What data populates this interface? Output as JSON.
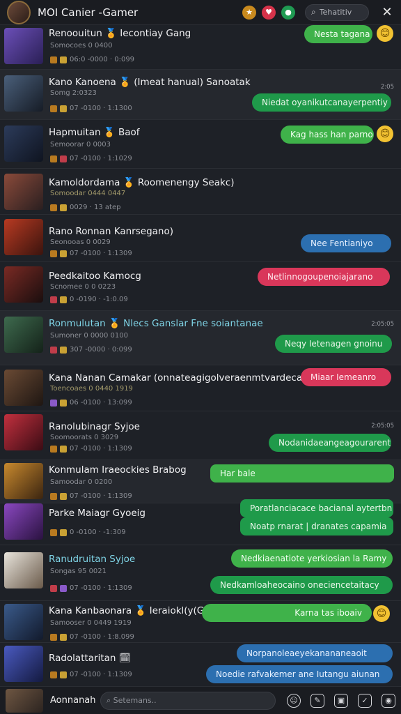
{
  "header": {
    "title": "MOI Canier -Gamer",
    "search_label": "Tehatitiv",
    "icons": [
      "gold-icon",
      "heart-icon",
      "green-circle-icon"
    ]
  },
  "rows": [
    {
      "name": "Renoouitun 🏅 Iecontiay Gang",
      "sub": "Somocoes 0 0400",
      "meta": "06:0 -0000  · 0:099",
      "time": "",
      "bubbles": [
        {
          "text": "Nesta tagana",
          "style": "b-lgreen"
        }
      ],
      "emoji": "😊"
    },
    {
      "name": "Kano Kanoena 🏅 (Imeat hanual) Sanoatak",
      "sub": "Somg 2:0323",
      "meta": "07 -0100  · 1:1300",
      "time": "2:05",
      "bubbles": [
        {
          "text": "Niedat oyanikutcanayerpentiy",
          "style": "b-green"
        }
      ],
      "emoji": ""
    },
    {
      "name": "Hapmuitan 🏅 Baof",
      "sub": "Semoorar 0 0003",
      "meta": "07 -0100  · 1:1029",
      "time": "",
      "bubbles": [
        {
          "text": "Kag  hass han parno",
          "style": "b-lgreen"
        }
      ],
      "emoji": "😊"
    },
    {
      "name": "Kamoldordama 🏅 Roomenengy Seakc)",
      "sub": "Somoodar 0444 0447",
      "meta": "0029  · 13 atep",
      "time": "",
      "bubbles": [],
      "emoji": ""
    },
    {
      "name": "Rano Ronnan Kanrsegano)",
      "sub": "Seonooas 0 0029",
      "meta": "07 -0100  · 1:1309",
      "time": "",
      "bubbles": [
        {
          "text": "Nee Fentianiyo",
          "style": "b-blue"
        }
      ],
      "emoji": ""
    },
    {
      "name": "Peedkaitoo Kamocg",
      "sub": "Scnomee 0 0 0223",
      "meta": "0 -0190  · -1:0.09",
      "time": "",
      "bubbles": [
        {
          "text": "Netlinnogoupenoiajarano",
          "style": "b-red"
        }
      ],
      "emoji": ""
    },
    {
      "name": "Ronmulutan 🏅 Nlecs Ganslar Fne soiantanae",
      "sub": "Sumoner 0 0000 0100",
      "meta": "307 -0000  · 0:099",
      "time": "2:05:05",
      "bubbles": [
        {
          "text": "Neqy Ietenagen gnoinu",
          "style": "b-green"
        }
      ],
      "emoji": ""
    },
    {
      "name": "Kana Nanan Camakar (onnateagigolveraenmtvardecanc)",
      "sub": "Toencoaes 0 0440 1919",
      "meta": "06 -0100  · 13:099",
      "time": "",
      "bubbles": [
        {
          "text": "Miaar Iemeanro",
          "style": "b-red"
        }
      ],
      "emoji": ""
    },
    {
      "name": "Ranolubinagr Syjoe",
      "sub": "Soomoorats 0 3029",
      "meta": "07 -0100  · 1:1309",
      "time": "2:05:05",
      "bubbles": [
        {
          "text": "Nodanidaeangeagourarent",
          "style": "b-green"
        }
      ],
      "emoji": ""
    },
    {
      "name": "Konmulam Iraeockies Brabog",
      "sub": "Samoodar 0 0200",
      "meta": "07 -0100  · 1:1309",
      "time": "",
      "bubbles": [
        {
          "text": "Har bale",
          "style": "b-lgreen"
        }
      ],
      "emoji": ""
    },
    {
      "name": "Parke Maiagr Gyoeig",
      "sub": "",
      "meta": "0 -0100  · -1:309",
      "time": "",
      "bubbles": [
        {
          "text": "Poratlanciacace bacianal aytertbn",
          "style": "b-green"
        },
        {
          "text": "Noatp rnarat | dranates capamia",
          "style": "b-green"
        }
      ],
      "emoji": ""
    },
    {
      "name": "Ranudruitan Syjoe",
      "sub": "Songas 95 0021",
      "meta": "07 -0100  · 1:1309",
      "time": "",
      "bubbles": [
        {
          "text": "Nedkiaenatiote yerkiosian la Ramy",
          "style": "b-lgreen"
        },
        {
          "text": "Nedkamloaheocaino oneciencetaitacy",
          "style": "b-green"
        }
      ],
      "emoji": ""
    },
    {
      "name": "Kana Kanbaonara 🏅 Ieraiokl(y(Gad",
      "sub": "Samooser 0 0449 1919",
      "meta": "07 -0100  · 1:8.099",
      "time": "",
      "bubbles": [
        {
          "text": "Karna tas iboaiv",
          "style": "b-lgreen"
        }
      ],
      "emoji": "😊"
    },
    {
      "name": "Radolattaritan 🗓",
      "sub": "",
      "meta": "07 -0100  · 1:1309",
      "time": "",
      "bubbles": [
        {
          "text": "Norpanoleaeyekanananeaoit",
          "style": "b-blue"
        },
        {
          "text": "Noedie rafvakemer ane Iutangu aiunan",
          "style": "b-blue"
        }
      ],
      "emoji": ""
    }
  ],
  "footer": {
    "user_name": "Aonnanah",
    "input_placeholder": "Setemans.."
  }
}
